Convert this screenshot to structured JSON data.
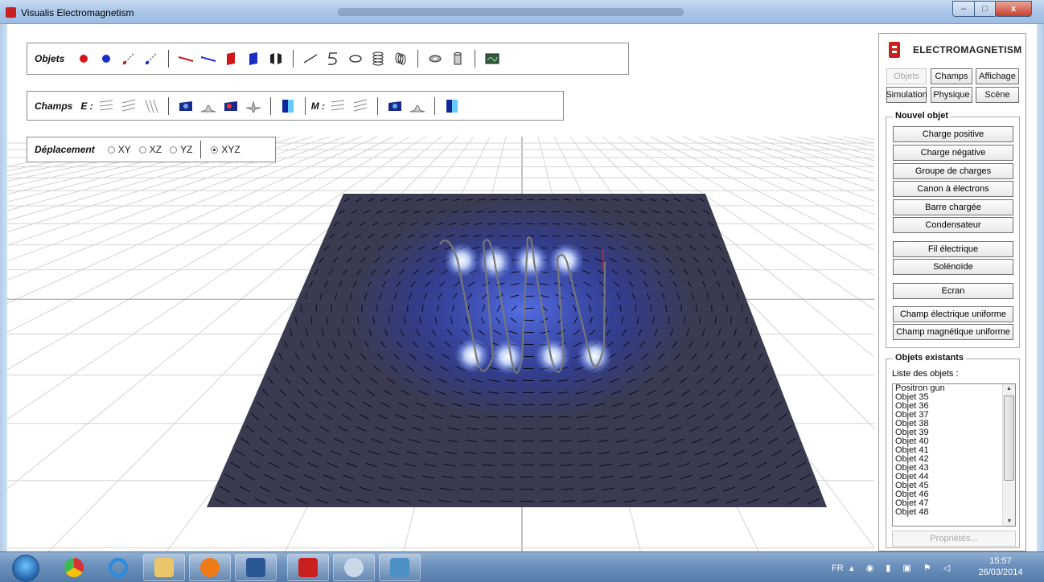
{
  "window": {
    "title": "Visualis Electromagnetism",
    "buttons": {
      "minimize": "–",
      "maximize": "□",
      "close": "x"
    }
  },
  "toolbars": {
    "objets": {
      "label": "Objets",
      "tools": [
        "positive-charge-icon",
        "negative-charge-icon",
        "positron-gun-icon",
        "electron-gun-icon",
        "positive-bar-icon",
        "negative-bar-icon",
        "positive-plate-icon",
        "negative-plate-icon",
        "capacitor-icon",
        "straight-wire-icon",
        "curved-wire-icon",
        "loop-icon",
        "solenoid-icon",
        "coil-icon",
        "ring-icon",
        "cylinder-icon",
        "screen-icon"
      ]
    },
    "champs": {
      "label": "Champs",
      "e_label": "E :",
      "m_label": "M :"
    },
    "deplacement": {
      "label": "Déplacement",
      "options": [
        "XY",
        "XZ",
        "YZ",
        "XYZ"
      ],
      "selected": "XYZ"
    }
  },
  "panel": {
    "brand": "ELECTROMAGNETISM",
    "tabs": {
      "objets": "Objets",
      "champs": "Champs",
      "affichage": "Affichage",
      "simulation": "Simulation",
      "physique": "Physique",
      "scene": "Scène"
    },
    "new_object": {
      "title": "Nouvel objet",
      "buttons": [
        "Charge positive",
        "Charge négative",
        "Groupe de charges",
        "Canon à électrons",
        "Barre chargée",
        "Condensateur",
        "Fil électrique",
        "Solénoïde",
        "Ecran",
        "Champ électrique uniforme",
        "Champ magnétique uniforme"
      ]
    },
    "existing": {
      "title": "Objets existants",
      "list_label": "Liste des objets :",
      "items": [
        "Positron gun",
        "Objet 35",
        "Objet 36",
        "Objet 37",
        "Objet 38",
        "Objet 39",
        "Objet 40",
        "Objet 41",
        "Objet 42",
        "Objet 43",
        "Objet 44",
        "Objet 45",
        "Objet 46",
        "Objet 47",
        "Objet 48"
      ],
      "properties_button": "Propriétés..."
    }
  },
  "taskbar": {
    "lang": "FR",
    "time": "15:57",
    "date": "26/03/2014"
  },
  "colors": {
    "accent": "#c8201e",
    "field_plane": "#3b3c52",
    "glow": "#3050ff"
  }
}
